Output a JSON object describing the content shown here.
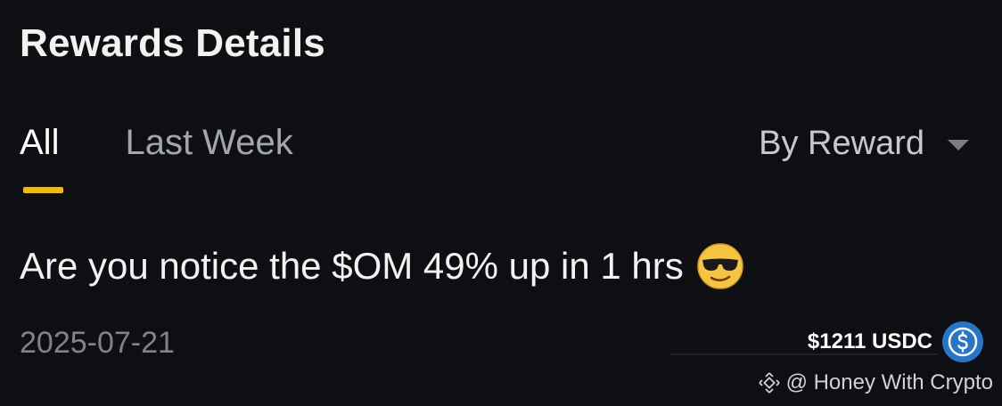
{
  "header": {
    "title": "Rewards Details"
  },
  "tabs": [
    {
      "label": "All",
      "active": true
    },
    {
      "label": "Last Week",
      "active": false
    }
  ],
  "sort": {
    "selected": "By Reward"
  },
  "reward": {
    "message": "Are you notice the $OM 49% up in 1 hrs",
    "emoji": "smiling-face-with-sunglasses",
    "date": "2025-07-21",
    "amount": "$1211 USDC",
    "token_icon": "usdc-icon"
  },
  "watermark": {
    "text": "@ Honey With Crypto",
    "logo": "binance-logo-icon"
  },
  "colors": {
    "background": "#0e0f13",
    "accent": "#f0b90b",
    "usdc_blue": "#2775ca"
  }
}
